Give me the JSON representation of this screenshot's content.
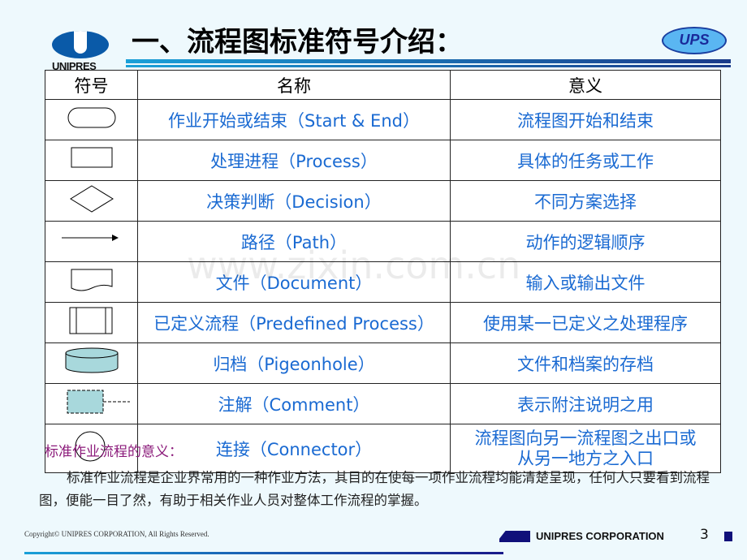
{
  "header": {
    "logo_text": "UNIPRES",
    "title": "一、流程图标准符号介绍：",
    "badge": "UPS"
  },
  "table": {
    "headers": [
      "符号",
      "名称",
      "意义"
    ],
    "rows": [
      {
        "symbol": "terminator",
        "name": "作业开始或结束（Start & End）",
        "meaning": "流程图开始和结束"
      },
      {
        "symbol": "process",
        "name": "处理进程（Process）",
        "meaning": "具体的任务或工作"
      },
      {
        "symbol": "decision",
        "name": "决策判断（Decision）",
        "meaning": "不同方案选择"
      },
      {
        "symbol": "arrow",
        "name": "路径（Path）",
        "meaning": "动作的逻辑顺序"
      },
      {
        "symbol": "document",
        "name": "文件（Document）",
        "meaning": "输入或输出文件"
      },
      {
        "symbol": "predefined",
        "name": "已定义流程（Predefined Process）",
        "meaning": "使用某一已定义之处理程序"
      },
      {
        "symbol": "cylinder",
        "name": "归档（Pigeonhole）",
        "meaning": "文件和档案的存档"
      },
      {
        "symbol": "comment",
        "name": "注解（Comment）",
        "meaning": "表示附注说明之用"
      },
      {
        "symbol": "circle",
        "name": "连接（Connector）",
        "meaning": "流程图向另一流程图之出口或从另一地方之入口"
      }
    ]
  },
  "note_title": "标准作业流程的意义：",
  "paragraph": "标准作业流程是企业界常用的一种作业方法，其目的在使每一项作业流程均能清楚呈现，任何人只要看到流程图，便能一目了然，有助于相关作业人员对整体工作流程的掌握。",
  "watermark": "www.zixin.com.cn",
  "footer": {
    "copyright": "Copyright© UNIPRES CORPORATION, All Rights Reserved.",
    "corp": "UNIPRES CORPORATION",
    "page": "3"
  }
}
